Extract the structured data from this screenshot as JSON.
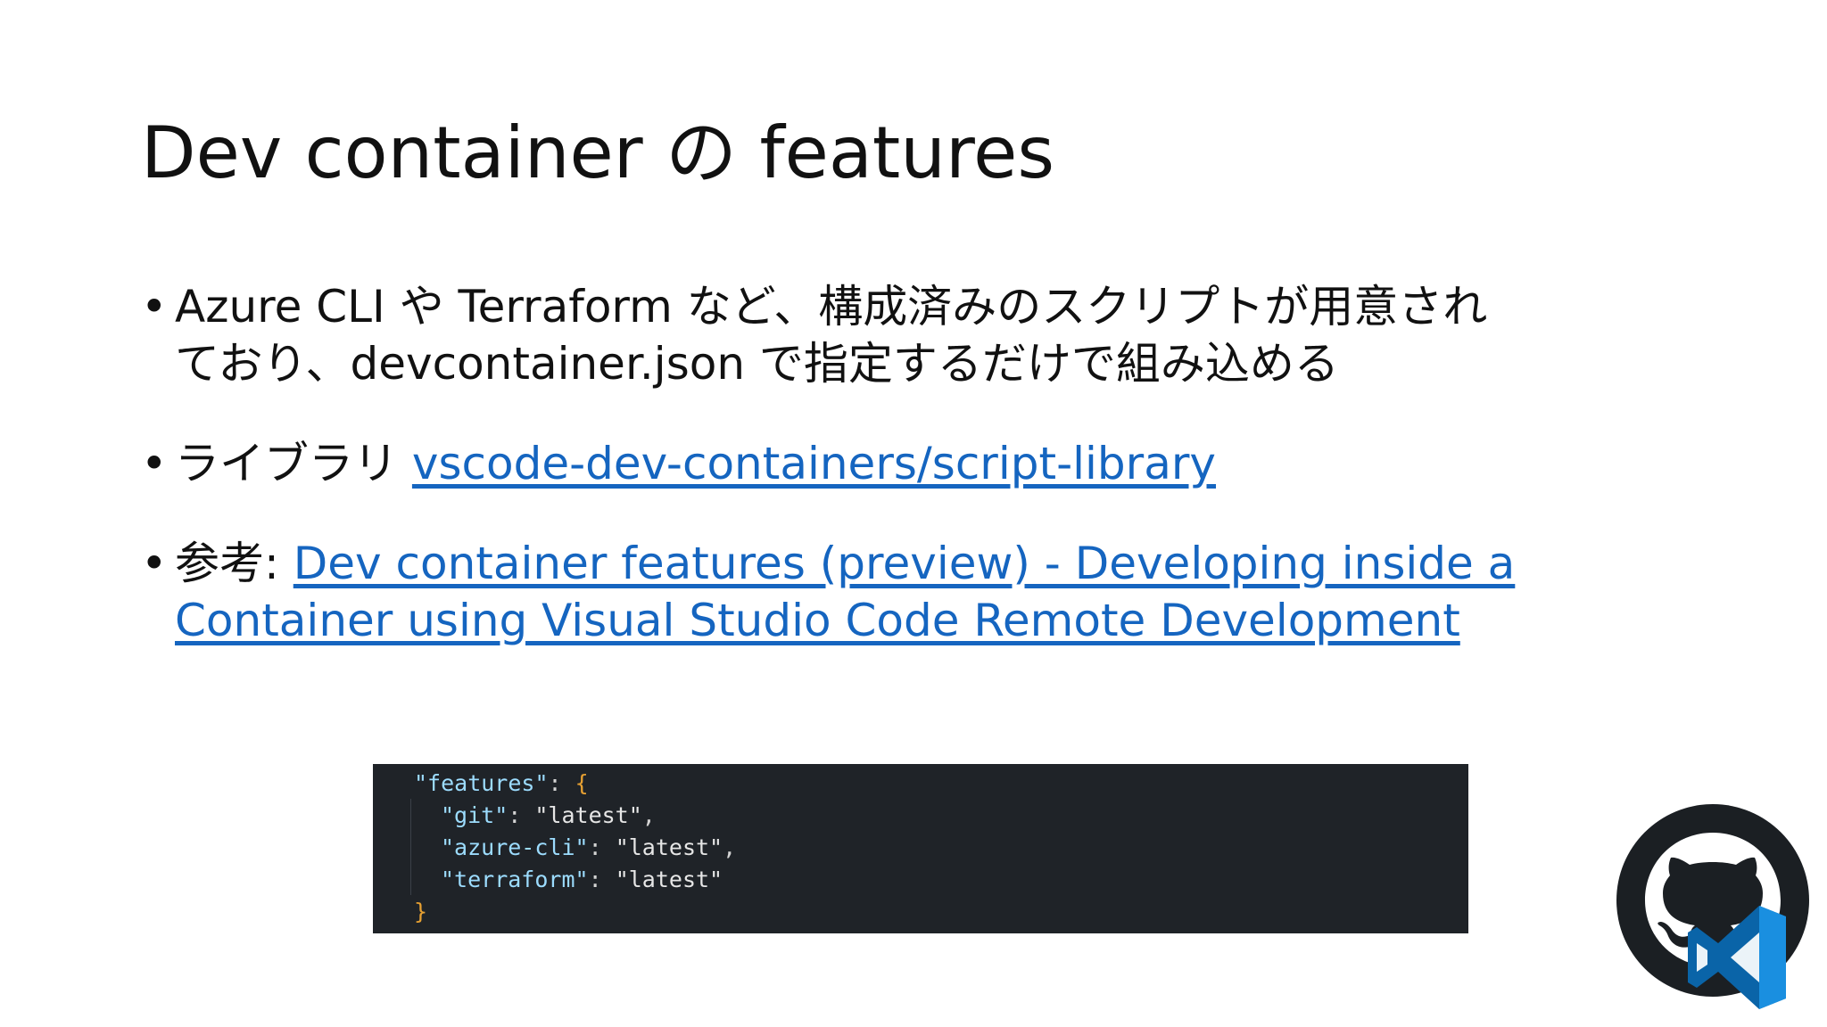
{
  "slide": {
    "title": "Dev container の features",
    "bullets": [
      {
        "line1": "Azure CLI や Terraform など、構成済みのスクリプトが用意され",
        "line2": "ており、devcontainer.json で指定するだけで組み込める"
      },
      {
        "prefix": "ライブラリ ",
        "link": "vscode-dev-containers/script-library"
      },
      {
        "prefix": "参考: ",
        "link_line1": "Dev container features (preview) - Developing inside a",
        "link_line2": "Container using Visual Studio Code Remote Development"
      }
    ],
    "code": {
      "line1_key": "\"features\"",
      "line1_punc": ": ",
      "line1_brace": "{",
      "git_key": "\"git\"",
      "git_value": "\"latest\"",
      "azure_key": "\"azure-cli\"",
      "azure_value": "\"latest\"",
      "terraform_key": "\"terraform\"",
      "terraform_value": "\"latest\"",
      "close_brace": "}"
    },
    "logos": {
      "primary": "github-octocat-icon",
      "secondary": "vscode-icon",
      "github_color": "#1b1f23",
      "vscode_color": "#0a7acc"
    }
  }
}
